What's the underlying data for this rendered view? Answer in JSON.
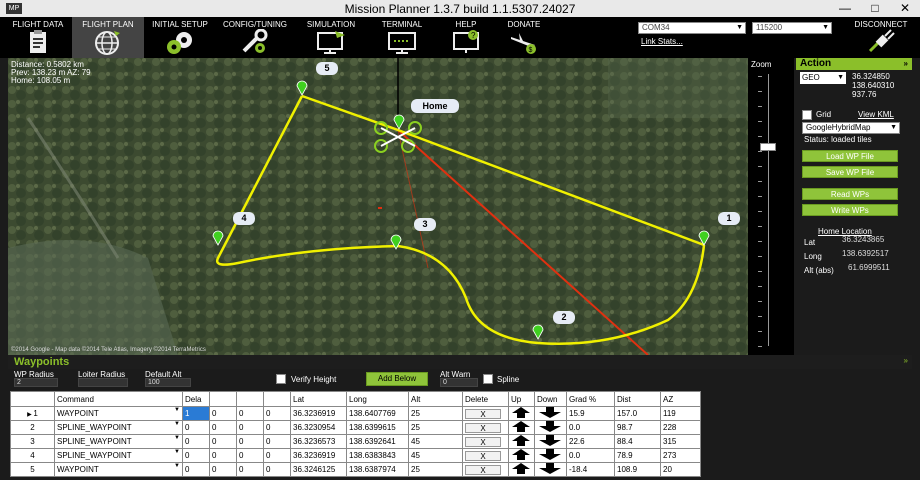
{
  "window": {
    "title": "Mission Planner 1.3.7 build 1.1.5307.24027",
    "logo": "MP",
    "min": "—",
    "max": "□",
    "close": "✕"
  },
  "menu": [
    {
      "label": "FLIGHT DATA",
      "icon": "clipboard-icon"
    },
    {
      "label": "FLIGHT PLAN",
      "icon": "globe-icon"
    },
    {
      "label": "INITIAL SETUP",
      "icon": "gears-icon"
    },
    {
      "label": "CONFIG/TUNING",
      "icon": "wrench-icon"
    },
    {
      "label": "SIMULATION",
      "icon": "monitor-plane-icon"
    },
    {
      "label": "TERMINAL",
      "icon": "terminal-icon"
    },
    {
      "label": "HELP",
      "icon": "help-monitor-icon"
    },
    {
      "label": "DONATE",
      "icon": "plane-dollar-icon"
    }
  ],
  "connection": {
    "port": "COM34",
    "baud": "115200",
    "link_stats": "Link Stats...",
    "disconnect": "DISCONNECT"
  },
  "map": {
    "distance": "Distance: 0.5802 km",
    "prev": "Prev: 138.23 m AZ: 79",
    "home": "Home: 108.05 m",
    "home_label": "Home",
    "copyright": "©2014 Google - Map data ©2014 Tele Atlas, Imagery ©2014 TerraMetrics",
    "waypoint_labels": [
      "1",
      "2",
      "3",
      "4",
      "5"
    ]
  },
  "zoom": {
    "title": "Zoom",
    "level": 0.27
  },
  "action": {
    "header": "Action",
    "coord_mode": "GEO",
    "lat": "36.324850",
    "lng": "138.640310",
    "alt": "937.76",
    "grid": "Grid",
    "view_kml": "View KML",
    "map_type": "GoogleHybridMap",
    "status": "Status: loaded tiles",
    "load_wp": "Load WP File",
    "save_wp": "Save WP File",
    "read_wps": "Read WPs",
    "write_wps": "Write WPs",
    "home_location": "Home Location",
    "home_lat_label": "Lat",
    "home_lat": "36.3243865",
    "home_lng_label": "Long",
    "home_lng": "138.6392517",
    "home_alt_label": "Alt (abs)",
    "home_alt": "61.6999511"
  },
  "waypoints": {
    "title": "Waypoints",
    "wp_radius_label": "WP Radius",
    "wp_radius": "2",
    "loiter_radius_label": "Loiter Radius",
    "loiter_radius": "",
    "default_alt_label": "Default Alt",
    "default_alt": "100",
    "verify_height": "Verify Height",
    "add_below": "Add Below",
    "alt_warn_label": "Alt Warn",
    "alt_warn": "0",
    "spline": "Spline",
    "columns": [
      "Command",
      "Dela",
      "",
      "",
      "",
      "Lat",
      "Long",
      "Alt",
      "Delete",
      "Up",
      "Down",
      "Grad %",
      "Dist",
      "AZ"
    ],
    "rows": [
      {
        "n": "1",
        "cmd": "WAYPOINT",
        "p1": "1",
        "p2": "0",
        "p3": "0",
        "p4": "0",
        "lat": "36.3236919",
        "lng": "138.6407769",
        "alt": "25",
        "del": "X",
        "grad": "15.9",
        "dist": "157.0",
        "az": "119"
      },
      {
        "n": "2",
        "cmd": "SPLINE_WAYPOINT",
        "p1": "0",
        "p2": "0",
        "p3": "0",
        "p4": "0",
        "lat": "36.3230954",
        "lng": "138.6399615",
        "alt": "25",
        "del": "X",
        "grad": "0.0",
        "dist": "98.7",
        "az": "228"
      },
      {
        "n": "3",
        "cmd": "SPLINE_WAYPOINT",
        "p1": "0",
        "p2": "0",
        "p3": "0",
        "p4": "0",
        "lat": "36.3236573",
        "lng": "138.6392641",
        "alt": "45",
        "del": "X",
        "grad": "22.6",
        "dist": "88.4",
        "az": "315"
      },
      {
        "n": "4",
        "cmd": "SPLINE_WAYPOINT",
        "p1": "0",
        "p2": "0",
        "p3": "0",
        "p4": "0",
        "lat": "36.3236919",
        "lng": "138.6383843",
        "alt": "45",
        "del": "X",
        "grad": "0.0",
        "dist": "78.9",
        "az": "273"
      },
      {
        "n": "5",
        "cmd": "WAYPOINT",
        "p1": "0",
        "p2": "0",
        "p3": "0",
        "p4": "0",
        "lat": "36.3246125",
        "lng": "138.6387974",
        "alt": "25",
        "del": "X",
        "grad": "-18.4",
        "dist": "108.9",
        "az": "20"
      }
    ]
  },
  "colors": {
    "accent": "#8bbf2a",
    "path": "#f0f000",
    "bearing": "#e03010",
    "pin": "#40d020"
  }
}
